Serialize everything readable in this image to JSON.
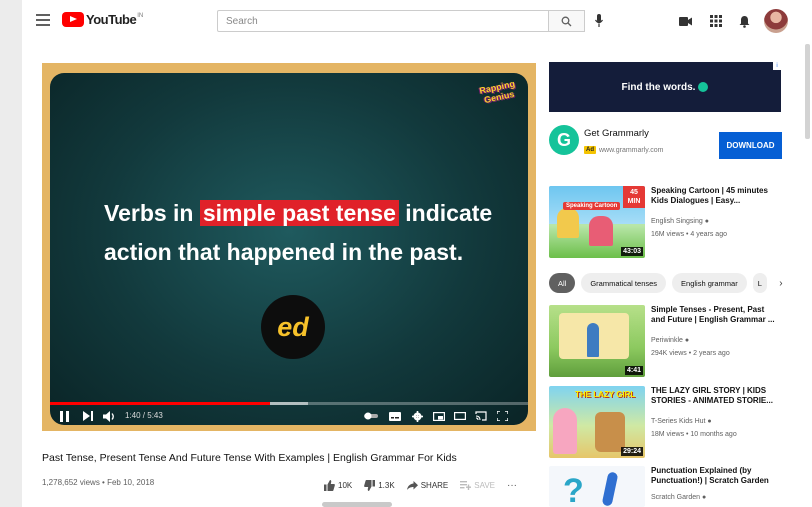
{
  "header": {
    "logo_text": "YouTube",
    "logo_sup": "IN",
    "search_placeholder": "Search"
  },
  "player": {
    "line1_before": "Verbs in ",
    "line1_highlight": "simple past tense",
    "line1_after": " indicate",
    "line2": "action that happened in the past.",
    "suffix_badge": "ed",
    "channel_badge": "Rapping Genius",
    "time": "1:40 / 5:43",
    "progress_played_fraction": 0.46,
    "progress_buffered_fraction": 0.54
  },
  "video": {
    "title": "Past Tense, Present Tense And Future Tense With Examples | English Grammar For Kids",
    "meta": "1,278,652 views • Feb 10, 2018",
    "like_count": "10K",
    "dislike_count": "1.3K",
    "share_label": "SHARE",
    "save_label": "SAVE"
  },
  "ad": {
    "banner_text": "Find the words.",
    "title": "Get Grammarly",
    "badge": "Ad",
    "url": "www.grammarly.com",
    "download_label": "DOWNLOAD"
  },
  "chips": [
    "All",
    "Grammatical tenses",
    "English grammar",
    "L"
  ],
  "recommendations": [
    {
      "title": "Speaking Cartoon | 45 minutes Kids Dialogues | Easy...",
      "channel": "English Singsing",
      "meta": "16M views • 4 years ago",
      "duration": "43:03",
      "thumb_badge": "45 MIN",
      "thumb_label": "Speaking Cartoon"
    },
    {
      "title": "Simple Tenses - Present, Past and Future | English Grammar ...",
      "channel": "Periwinkle",
      "meta": "294K views • 2 years ago",
      "duration": "4:41"
    },
    {
      "title": "THE LAZY GIRL STORY | KIDS STORIES - ANIMATED STORIE...",
      "channel": "T-Series Kids Hut",
      "meta": "18M views • 10 months ago",
      "duration": "29:24",
      "thumb_label": "THE LAZY GIRL"
    },
    {
      "title": "Punctuation Explained (by Punctuation!) | Scratch Garden",
      "channel": "Scratch Garden",
      "meta": "",
      "duration": ""
    }
  ],
  "colors": {
    "brand_red": "#ff0000",
    "highlight_red": "#e02129",
    "ed_yellow": "#f6c12a",
    "grammarly_green": "#15c39a",
    "download_blue": "#065fd4"
  }
}
